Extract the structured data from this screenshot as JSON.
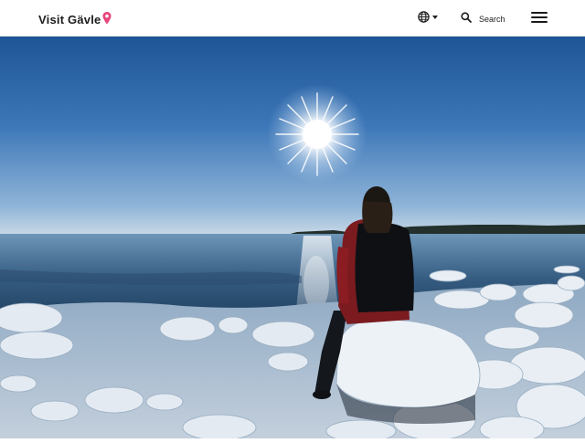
{
  "header": {
    "logo_text": "Visit Gävle",
    "search_label": "Search",
    "icons": {
      "language": "globe-icon",
      "language_caret": "chevron-down-icon",
      "search": "search-icon",
      "menu": "hamburger-menu-icon",
      "logo_pin": "location-pin-icon"
    }
  },
  "colors": {
    "brand_pink": "#e8447c",
    "header_bg": "#ffffff",
    "text_dark": "#1c1c1c"
  },
  "hero": {
    "image_subject": "hero-photo"
  }
}
